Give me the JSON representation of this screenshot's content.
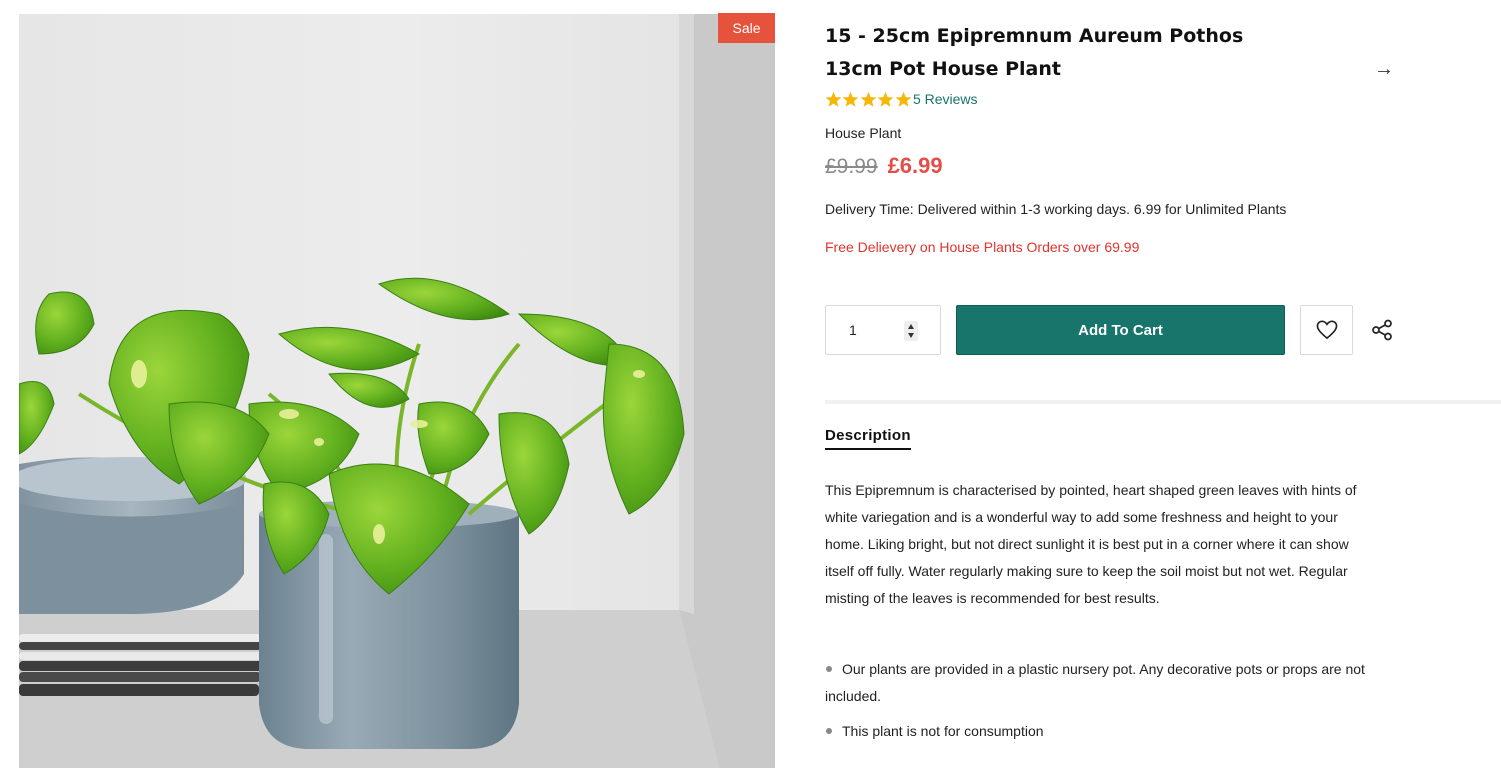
{
  "product": {
    "badge": "Sale",
    "title": "15 - 25cm Epipremnum Aureum Pothos 13cm Pot House Plant",
    "rating": 5,
    "reviews_label": "5 Reviews",
    "type": "House Plant",
    "price_old": "£9.99",
    "price_new": "£6.99",
    "delivery": "Delivery Time: Delivered within 1-3 working days. 6.99 for Unlimited Plants",
    "free_delivery": "Free Delievery on House Plants Orders over 69.99"
  },
  "purchase": {
    "quantity": "1",
    "add_to_cart_label": "Add To Cart"
  },
  "tabs": {
    "description_label": "Description"
  },
  "description": {
    "text": "This Epipremnum is characterised by pointed, heart shaped green leaves with hints of white variegation and is a wonderful way to add some freshness and height to your home. Liking bright, but not direct sunlight it is best put in a corner where it can show itself off fully. Water regularly making sure to keep the soil moist but not wet. Regular misting of the leaves is recommended for best results.",
    "bullets": [
      "Our plants are provided in a plastic nursery pot. Any decorative pots or props are not included.",
      "This plant is not for consumption"
    ]
  },
  "icons": {
    "next": "arrow-right-icon",
    "star": "star-icon",
    "wishlist": "heart-icon",
    "share": "share-icon",
    "spin_up": "caret-up-icon",
    "spin_down": "caret-down-icon"
  },
  "colors": {
    "accent": "#17756b",
    "sale_badge": "#e5533d",
    "price_new": "#e24f4a",
    "free_delivery": "#e0342c",
    "star": "#f5b80a"
  }
}
